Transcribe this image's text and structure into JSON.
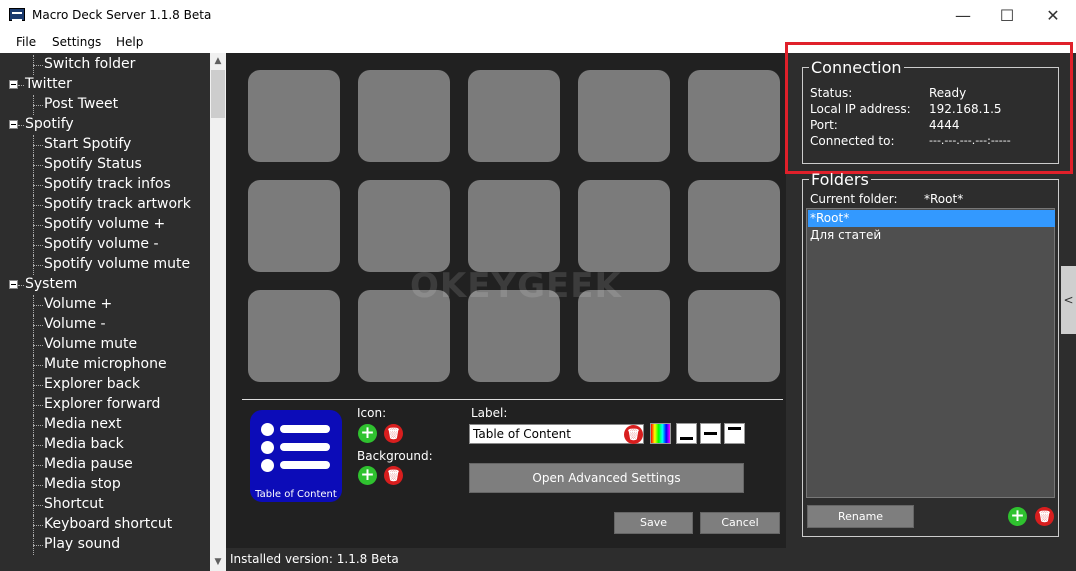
{
  "window": {
    "title": "Macro Deck Server 1.1.8 Beta",
    "minimize_glyph": "—",
    "maximize_glyph": "☐",
    "close_glyph": "✕"
  },
  "menu": {
    "file": "File",
    "settings": "Settings",
    "help": "Help"
  },
  "tree": {
    "items": [
      {
        "label": "Switch folder",
        "level": 1
      },
      {
        "label": "Twitter",
        "level": 0
      },
      {
        "label": "Post Tweet",
        "level": 1
      },
      {
        "label": "Spotify",
        "level": 0
      },
      {
        "label": "Start Spotify",
        "level": 1
      },
      {
        "label": "Spotify Status",
        "level": 1
      },
      {
        "label": "Spotify track infos",
        "level": 1
      },
      {
        "label": "Spotify track artwork",
        "level": 1
      },
      {
        "label": "Spotify volume +",
        "level": 1
      },
      {
        "label": "Spotify volume -",
        "level": 1
      },
      {
        "label": "Spotify volume mute",
        "level": 1
      },
      {
        "label": "System",
        "level": 0
      },
      {
        "label": "Volume +",
        "level": 1
      },
      {
        "label": "Volume -",
        "level": 1
      },
      {
        "label": "Volume mute",
        "level": 1
      },
      {
        "label": "Mute microphone",
        "level": 1
      },
      {
        "label": "Explorer back",
        "level": 1
      },
      {
        "label": "Explorer forward",
        "level": 1
      },
      {
        "label": "Media next",
        "level": 1
      },
      {
        "label": "Media back",
        "level": 1
      },
      {
        "label": "Media pause",
        "level": 1
      },
      {
        "label": "Media stop",
        "level": 1
      },
      {
        "label": "Shortcut",
        "level": 1
      },
      {
        "label": "Keyboard shortcut",
        "level": 1
      },
      {
        "label": "Play sound",
        "level": 1
      }
    ]
  },
  "editor": {
    "preview_caption": "Table of Content",
    "icon_label": "Icon:",
    "background_label": "Background:",
    "label_label": "Label:",
    "label_value": "Table of Content",
    "advanced_button": "Open Advanced Settings",
    "save_button": "Save",
    "cancel_button": "Cancel"
  },
  "status_bar": {
    "text": "Installed version: 1.1.8 Beta"
  },
  "connection": {
    "title": "Connection",
    "status_key": "Status:",
    "status_value": "Ready",
    "ip_key": "Local IP address:",
    "ip_value": "192.168.1.5",
    "port_key": "Port:",
    "port_value": "4444",
    "connected_key": "Connected to:",
    "connected_value": "---.---.---.---:-----"
  },
  "folders": {
    "title": "Folders",
    "current_key": "Current folder:",
    "current_value": "*Root*",
    "items": [
      "*Root*",
      "Для статей"
    ],
    "selected_index": 0,
    "rename_button": "Rename"
  },
  "collapse_tab": "<",
  "watermark": "OKEYGEEK",
  "colors": {
    "accent_selection": "#3399ff",
    "highlight_red": "#e0202a",
    "add_green": "#2fc22f",
    "delete_red": "#d81e1e",
    "preview_blue": "#0c0cb8"
  }
}
